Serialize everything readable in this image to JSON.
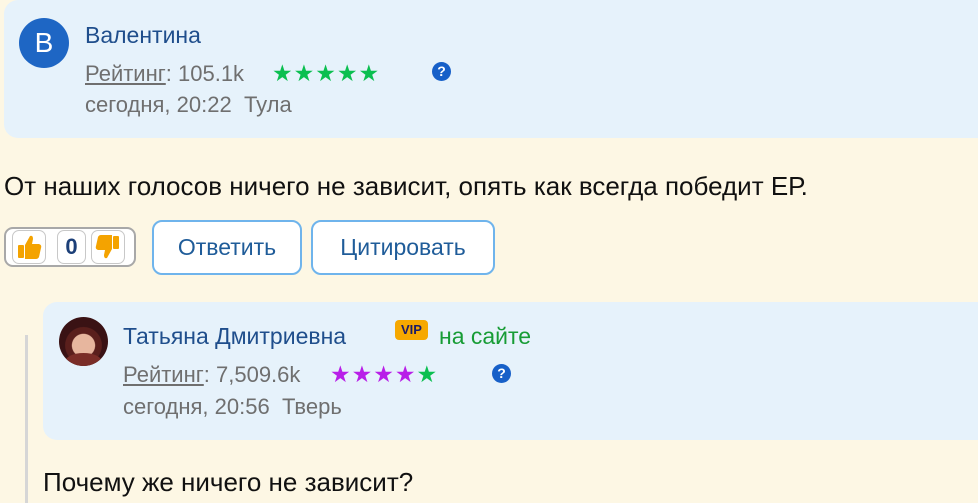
{
  "comment1": {
    "avatar_letter": "В",
    "author": "Валентина",
    "rating_label": "Рейтинг",
    "rating_value": ": 105.1k",
    "stars": "★★★★★",
    "help": "?",
    "time": "сегодня, 20:22",
    "city": "Тула",
    "text": "От наших голосов ничего не зависит, опять как всегда победит ЕР.",
    "votes": "0",
    "reply_label": "Ответить",
    "quote_label": "Цитировать"
  },
  "comment2": {
    "author": "Татьяна Дмитриевна",
    "vip": "VIP",
    "online": "на сайте",
    "rating_label": "Рейтинг",
    "rating_value": ": 7,509.6k",
    "stars_purple": "★★★★",
    "stars_green": "★",
    "help": "?",
    "time": "сегодня, 20:56",
    "city": "Тверь",
    "text": "Почему же ничего не зависит?"
  },
  "colors": {
    "card_bg": "#e6f2fb",
    "page_bg": "#fdf7e4",
    "name_blue": "#1f4e8c",
    "star_green": "#0bbf50",
    "star_purple": "#b81fe8",
    "vip_orange": "#f6a800"
  }
}
